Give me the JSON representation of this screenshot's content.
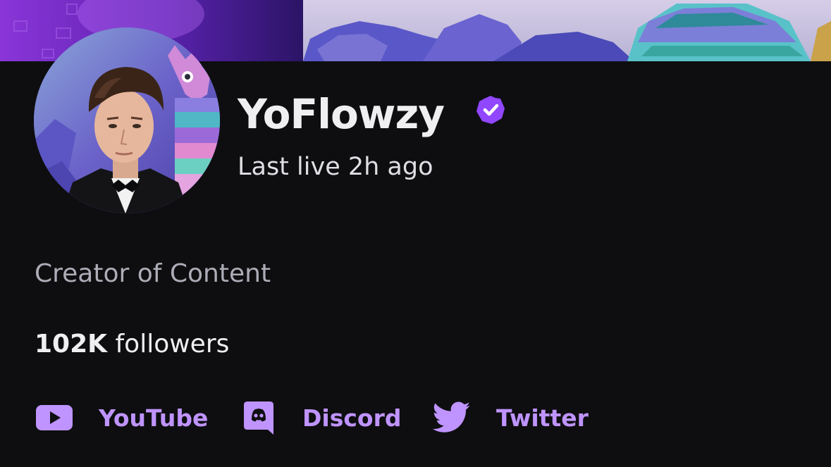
{
  "channel": {
    "display_name": "YoFlowzy",
    "verified": true,
    "last_live": "Last live 2h ago",
    "bio": "Creator of Content",
    "followers_count": "102K",
    "followers_label": "followers"
  },
  "social_links": [
    {
      "label": "YouTube",
      "icon": "youtube-icon"
    },
    {
      "label": "Discord",
      "icon": "discord-icon"
    },
    {
      "label": "Twitter",
      "icon": "twitter-icon"
    }
  ],
  "colors": {
    "background": "#0e0e10",
    "accent": "#bf94ff",
    "verified_badge": "#9147ff",
    "primary_text": "#efeff1",
    "secondary_text": "#adadb8"
  }
}
